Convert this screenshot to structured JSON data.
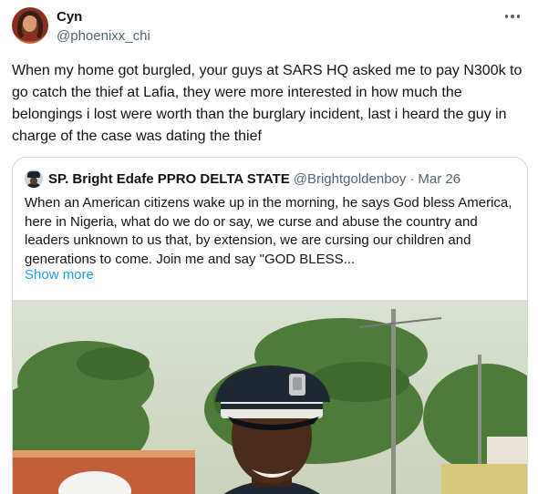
{
  "tweet": {
    "author_name": "Cyn",
    "author_handle": "@phoenixx_chi",
    "more_icon": "more-horizontal-icon",
    "text": "When my home got burgled, your guys at SARS HQ asked me to pay N300k to go catch the thief at Lafia, they were more interested in how much the belongings i lost were worth than the burglary incident, last i heard the guy in charge of the case was dating the thief"
  },
  "quoted_tweet": {
    "author_name": "SP. Bright Edafe PPRO DELTA STATE",
    "author_handle": "@Brightgoldenboy",
    "separator": "·",
    "date": "Mar 26",
    "text": "When an American citizens wake up in the morning, he says God bless America, here in Nigeria, what do we do or say, we curse and abuse the country and leaders unknown to us that, by extension, we are cursing our children and generations to come. Join me and say \"GOD BLESS...",
    "show_more_label": "Show more"
  },
  "colors": {
    "text_primary": "#0f1419",
    "text_secondary": "#536471",
    "link": "#1d9bf0",
    "border": "#cfd9de"
  }
}
